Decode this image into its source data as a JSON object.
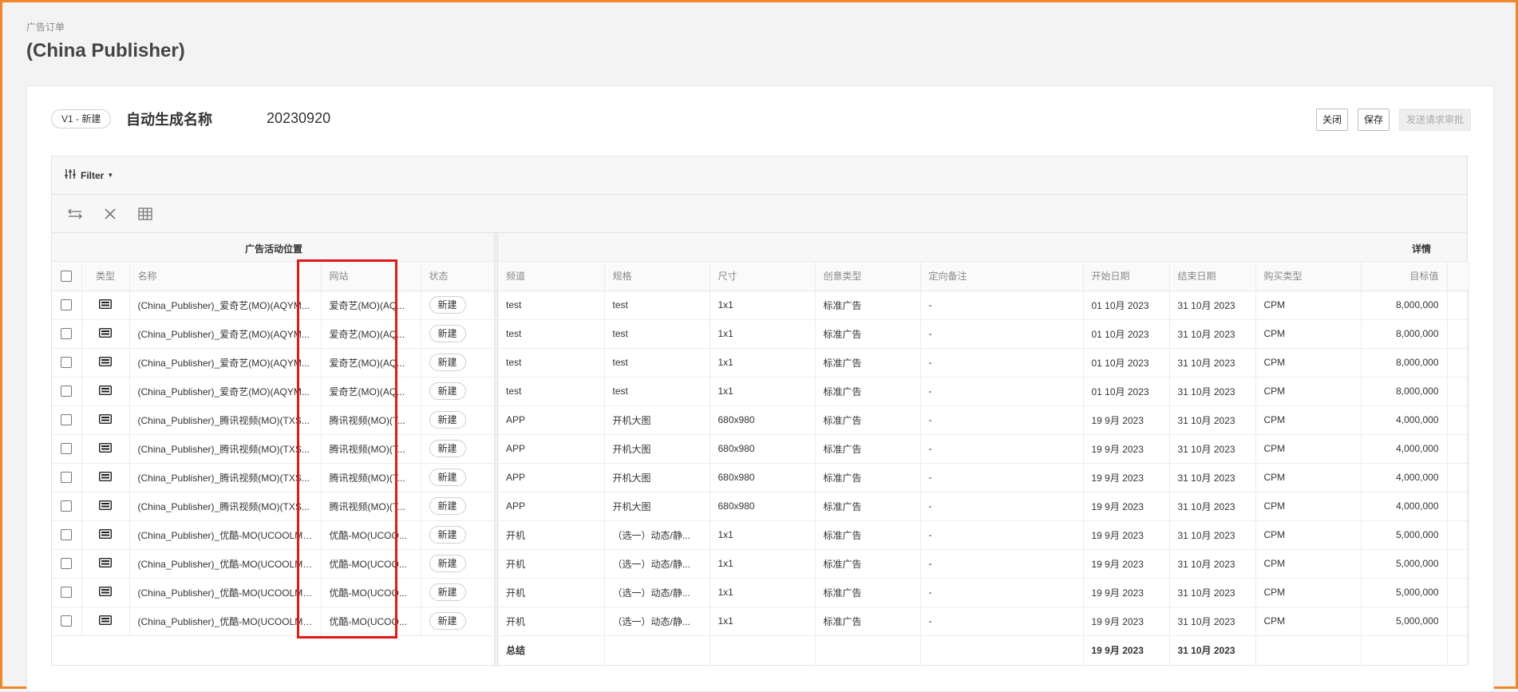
{
  "breadcrumb": "广告订单",
  "page_title": "(China Publisher)",
  "header": {
    "version_badge": "V1 - 新建",
    "order_name": "自动生成名称",
    "order_id": "20230920",
    "buttons": {
      "close": "关闭",
      "save": "保存",
      "submit": "发送请求审批"
    }
  },
  "filter": {
    "label": "Filter"
  },
  "toolbar_icons": [
    "swap-icon",
    "close-icon",
    "grid-icon"
  ],
  "left_group_title": "广告活动位置",
  "right_group_title": "详情",
  "left_columns": {
    "type": "类型",
    "name": "名称",
    "site": "网站",
    "status": "状态"
  },
  "right_columns": {
    "channel": "频道",
    "spec": "规格",
    "size": "尺寸",
    "creative": "创意类型",
    "note": "定向备注",
    "start": "开始日期",
    "end": "结束日期",
    "buy": "购买类型",
    "target": "目标值"
  },
  "rows": [
    {
      "name": "(China_Publisher)_爱奇艺(MO)(AQYM...",
      "site": "爱奇艺(MO)(AQ...",
      "status": "新建",
      "channel": "test",
      "spec": "test",
      "size": "1x1",
      "creative": "标准广告",
      "note": "-",
      "start": "01 10月 2023",
      "end": "31 10月 2023",
      "buy": "CPM",
      "target": "8,000,000"
    },
    {
      "name": "(China_Publisher)_爱奇艺(MO)(AQYM...",
      "site": "爱奇艺(MO)(AQ...",
      "status": "新建",
      "channel": "test",
      "spec": "test",
      "size": "1x1",
      "creative": "标准广告",
      "note": "-",
      "start": "01 10月 2023",
      "end": "31 10月 2023",
      "buy": "CPM",
      "target": "8,000,000"
    },
    {
      "name": "(China_Publisher)_爱奇艺(MO)(AQYM...",
      "site": "爱奇艺(MO)(AQ...",
      "status": "新建",
      "channel": "test",
      "spec": "test",
      "size": "1x1",
      "creative": "标准广告",
      "note": "-",
      "start": "01 10月 2023",
      "end": "31 10月 2023",
      "buy": "CPM",
      "target": "8,000,000"
    },
    {
      "name": "(China_Publisher)_爱奇艺(MO)(AQYM...",
      "site": "爱奇艺(MO)(AQ...",
      "status": "新建",
      "channel": "test",
      "spec": "test",
      "size": "1x1",
      "creative": "标准广告",
      "note": "-",
      "start": "01 10月 2023",
      "end": "31 10月 2023",
      "buy": "CPM",
      "target": "8,000,000"
    },
    {
      "name": "(China_Publisher)_腾讯视频(MO)(TXS...",
      "site": "腾讯视频(MO)(T...",
      "status": "新建",
      "channel": "APP",
      "spec": "开机大图",
      "size": "680x980",
      "creative": "标准广告",
      "note": "-",
      "start": "19 9月 2023",
      "end": "31 10月 2023",
      "buy": "CPM",
      "target": "4,000,000"
    },
    {
      "name": "(China_Publisher)_腾讯视频(MO)(TXS...",
      "site": "腾讯视频(MO)(T...",
      "status": "新建",
      "channel": "APP",
      "spec": "开机大图",
      "size": "680x980",
      "creative": "标准广告",
      "note": "-",
      "start": "19 9月 2023",
      "end": "31 10月 2023",
      "buy": "CPM",
      "target": "4,000,000"
    },
    {
      "name": "(China_Publisher)_腾讯视频(MO)(TXS...",
      "site": "腾讯视频(MO)(T...",
      "status": "新建",
      "channel": "APP",
      "spec": "开机大图",
      "size": "680x980",
      "creative": "标准广告",
      "note": "-",
      "start": "19 9月 2023",
      "end": "31 10月 2023",
      "buy": "CPM",
      "target": "4,000,000"
    },
    {
      "name": "(China_Publisher)_腾讯视频(MO)(TXS...",
      "site": "腾讯视频(MO)(T...",
      "status": "新建",
      "channel": "APP",
      "spec": "开机大图",
      "size": "680x980",
      "creative": "标准广告",
      "note": "-",
      "start": "19 9月 2023",
      "end": "31 10月 2023",
      "buy": "CPM",
      "target": "4,000,000"
    },
    {
      "name": "(China_Publisher)_优酷-MO(UCOOLMO...",
      "site": "优酷-MO(UCOO...",
      "status": "新建",
      "channel": "开机",
      "spec": "（选一）动态/静...",
      "size": "1x1",
      "creative": "标准广告",
      "note": "-",
      "start": "19 9月 2023",
      "end": "31 10月 2023",
      "buy": "CPM",
      "target": "5,000,000"
    },
    {
      "name": "(China_Publisher)_优酷-MO(UCOOLMO...",
      "site": "优酷-MO(UCOO...",
      "status": "新建",
      "channel": "开机",
      "spec": "（选一）动态/静...",
      "size": "1x1",
      "creative": "标准广告",
      "note": "-",
      "start": "19 9月 2023",
      "end": "31 10月 2023",
      "buy": "CPM",
      "target": "5,000,000"
    },
    {
      "name": "(China_Publisher)_优酷-MO(UCOOLMO...",
      "site": "优酷-MO(UCOO...",
      "status": "新建",
      "channel": "开机",
      "spec": "（选一）动态/静...",
      "size": "1x1",
      "creative": "标准广告",
      "note": "-",
      "start": "19 9月 2023",
      "end": "31 10月 2023",
      "buy": "CPM",
      "target": "5,000,000"
    },
    {
      "name": "(China_Publisher)_优酷-MO(UCOOLMO...",
      "site": "优酷-MO(UCOO...",
      "status": "新建",
      "channel": "开机",
      "spec": "（选一）动态/静...",
      "size": "1x1",
      "creative": "标准广告",
      "note": "-",
      "start": "19 9月 2023",
      "end": "31 10月 2023",
      "buy": "CPM",
      "target": "5,000,000"
    }
  ],
  "summary": {
    "label": "总结",
    "start": "19 9月 2023",
    "end": "31 10月 2023"
  },
  "colors": {
    "highlight": "#e0191a",
    "window_border": "#f0862a"
  }
}
